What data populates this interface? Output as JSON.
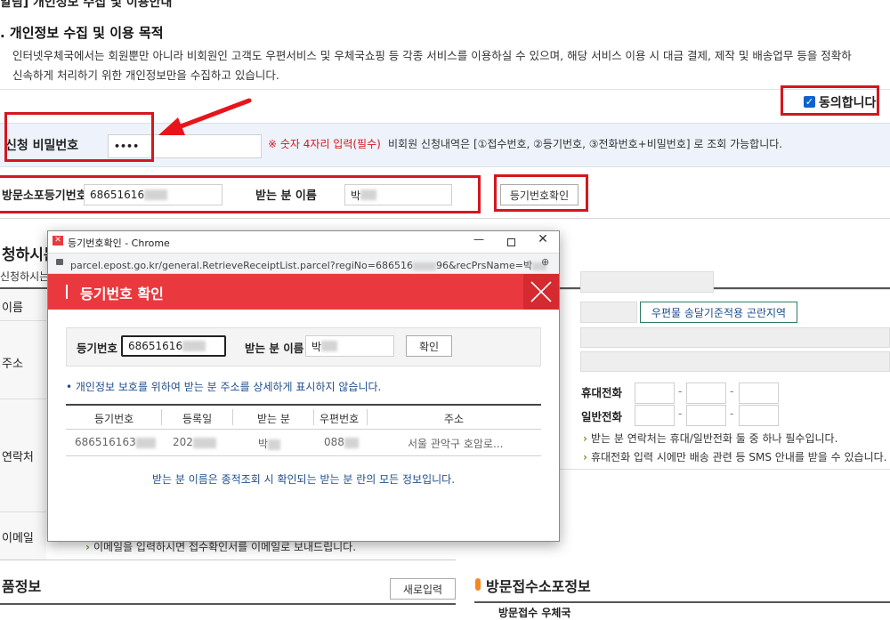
{
  "section_top_title": "알림] 개인정보 수집 및 이용안내",
  "purpose": {
    "title": ". 개인정보 수집 및 이용 목적",
    "line1": "인터넷우체국에서는 회원뿐만 아니라 비회원인 고객도 우편서비스 및 우체국쇼핑 등 각종 서비스를 이용하실 수 있으며, 해당 서비스 이용 시 대금 결제, 제작 및 배송업무 등을 정확하",
    "line2": "신속하게 처리하기 위한 개인정보만을 수집하고 있습니다."
  },
  "agree": {
    "label": "동의합니다",
    "checked": true
  },
  "password": {
    "label": "신청 비밀번호",
    "value": "••••",
    "note_required": "※ 숫자 4자리 입력(필수)",
    "note_info": "비회원 신청내역은 [①접수번호, ②등기번호, ③전화번호+비밀번호] 로 조회 가능합니다."
  },
  "registry_row": {
    "label": "방문소포등기번호",
    "value": "68651616",
    "recipient_label": "받는 분 이름",
    "recipient_value": "박",
    "confirm_button": "등기번호확인"
  },
  "applicant": {
    "section_title": "청하시는",
    "subtitle": "신청하시는",
    "name_label": "이름",
    "address_label": "주소",
    "contact_label": "연락처",
    "email_label": "이메일",
    "region_button": "우편물 송달기준적용 곤란지역",
    "mobile_label": "휴대전화",
    "phone_label": "일반전화",
    "phone_dash": "-",
    "note1": "받는 분 연락처는 휴대/일반전화 둘 중 하나 필수입니다.",
    "note2": "휴대전화 입력 시에만 배송 관련 등 SMS 안내를 받을 수 있습니다.",
    "email_note": "이메일을 입력하시면 접수확인서를 이메일로 보내드립니다."
  },
  "product": {
    "title": "품정보",
    "new_button": "새로입력"
  },
  "visit_info": {
    "title": "방문접수소포정보",
    "sub": "방문접수 우체국"
  },
  "popup": {
    "window_title": "등기번호확인 - Chrome",
    "url": "parcel.epost.go.kr/general.RetrieveReceiptList.parcel?regiNo=686516",
    "url_tail": "96&recPrsName=박",
    "header_title": "등기번호 확인",
    "search": {
      "reg_label": "등기번호",
      "reg_value": "68651616",
      "name_label": "받는 분 이름",
      "name_value": "박",
      "button": "확인"
    },
    "privacy_note": "• 개인정보 보호를 위하여 받는 분 주소를 상세하게 표시하지 않습니다.",
    "table": {
      "headers": [
        "등기번호",
        "등록일",
        "받는 분",
        "우편번호",
        "주소"
      ],
      "row": [
        "686516163",
        "202",
        "박",
        "088",
        "서울 관악구 호암로..."
      ]
    },
    "footer_note": "받는 분 이름은 종적조회 시 확인되는 받는 분 란의 모든 정보입니다."
  },
  "colors": {
    "accent_red": "#d4171e",
    "popup_header": "#e9393f",
    "link_blue": "#1f4e8c",
    "bullet_green": "#6f9b2c"
  }
}
